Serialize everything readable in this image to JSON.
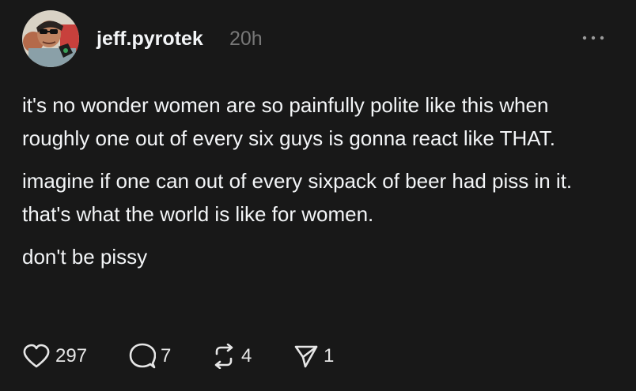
{
  "post": {
    "username": "jeff.pyrotek",
    "timestamp": "20h",
    "paragraphs": [
      "it's no wonder women are so painfully polite like this when roughly one out of every six guys is gonna react like THAT.",
      "imagine if one can out of every sixpack of beer had piss in it. that's what the world is like for women.",
      "don't be pissy"
    ]
  },
  "actions": {
    "like_count": "297",
    "reply_count": "7",
    "repost_count": "4",
    "share_count": "1"
  },
  "icons": {
    "avatar": "avatar-photo",
    "more": "more-icon",
    "like": "heart-icon",
    "reply": "comment-icon",
    "repost": "repost-icon",
    "share": "share-icon"
  },
  "colors": {
    "background": "#181818",
    "text": "#f3f5f7",
    "muted": "#777777"
  }
}
